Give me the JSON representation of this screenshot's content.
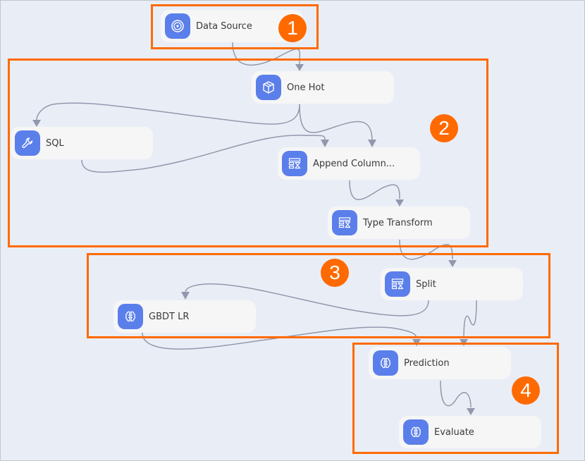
{
  "canvas": {
    "background": "#e9eef6",
    "frame_color": "#ff6a00",
    "node_icon_color": "#5b7fea",
    "edge_color": "#9397ad"
  },
  "nodes": [
    {
      "id": "data-source",
      "label": "Data Source",
      "icon": "target-icon"
    },
    {
      "id": "one-hot",
      "label": "One Hot",
      "icon": "cube-icon"
    },
    {
      "id": "sql",
      "label": "SQL",
      "icon": "wrench-icon"
    },
    {
      "id": "append-column",
      "label": "Append Column...",
      "icon": "table-transform-icon"
    },
    {
      "id": "type-transform",
      "label": "Type Transform",
      "icon": "table-transform-icon"
    },
    {
      "id": "split",
      "label": "Split",
      "icon": "table-transform-icon"
    },
    {
      "id": "gbdt-lr",
      "label": "GBDT LR",
      "icon": "brain-icon"
    },
    {
      "id": "prediction",
      "label": "Prediction",
      "icon": "brain-icon"
    },
    {
      "id": "evaluate",
      "label": "Evaluate",
      "icon": "brain-icon"
    }
  ],
  "edges": [
    {
      "from": "data-source",
      "to": "one-hot"
    },
    {
      "from": "one-hot",
      "to": "sql"
    },
    {
      "from": "one-hot",
      "to": "append-column"
    },
    {
      "from": "sql",
      "to": "append-column"
    },
    {
      "from": "append-column",
      "to": "type-transform"
    },
    {
      "from": "type-transform",
      "to": "split"
    },
    {
      "from": "split",
      "to": "gbdt-lr"
    },
    {
      "from": "split",
      "to": "prediction"
    },
    {
      "from": "gbdt-lr",
      "to": "prediction"
    },
    {
      "from": "prediction",
      "to": "evaluate"
    }
  ],
  "groups": [
    {
      "number": "1",
      "members": [
        "data-source"
      ]
    },
    {
      "number": "2",
      "members": [
        "one-hot",
        "sql",
        "append-column",
        "type-transform"
      ]
    },
    {
      "number": "3",
      "members": [
        "split",
        "gbdt-lr"
      ]
    },
    {
      "number": "4",
      "members": [
        "prediction",
        "evaluate"
      ]
    }
  ]
}
